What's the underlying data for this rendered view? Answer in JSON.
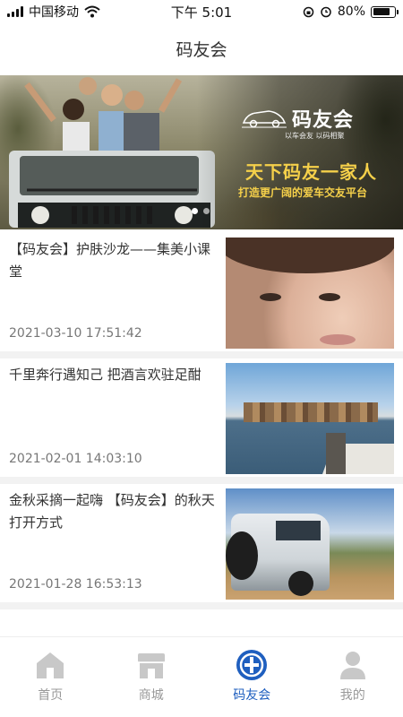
{
  "status_bar": {
    "carrier": "中国移动",
    "time": "下午 5:01",
    "battery": "80%",
    "battery_level": 0.8
  },
  "nav": {
    "title": "码友会"
  },
  "banner": {
    "brand": "码友会",
    "subtitle": "以车会友  以码相聚",
    "slogan": "天下码友一家人",
    "slogan2": "打造更广阔的爱车交友平台",
    "slide_count": 2,
    "active_slide": 1
  },
  "articles": [
    {
      "title": "【码友会】护肤沙龙——集美小课堂",
      "date": "2021-03-10 17:51:42",
      "thumb": "face"
    },
    {
      "title": "千里奔行遇知己 把酒言欢驻足酣",
      "date": "2021-02-01 14:03:10",
      "thumb": "lake"
    },
    {
      "title": "金秋采摘一起嗨 【码友会】的秋天打开方式",
      "date": "2021-01-28 16:53:13",
      "thumb": "suv"
    }
  ],
  "tabs": [
    {
      "label": "首页",
      "icon": "home-icon",
      "active": false
    },
    {
      "label": "商城",
      "icon": "store-icon",
      "active": false
    },
    {
      "label": "码友会",
      "icon": "club-icon",
      "active": true
    },
    {
      "label": "我的",
      "icon": "user-icon",
      "active": false
    }
  ],
  "colors": {
    "accent": "#1f5fbf",
    "inactive": "#999999",
    "banner_text": "#f5d04a"
  }
}
